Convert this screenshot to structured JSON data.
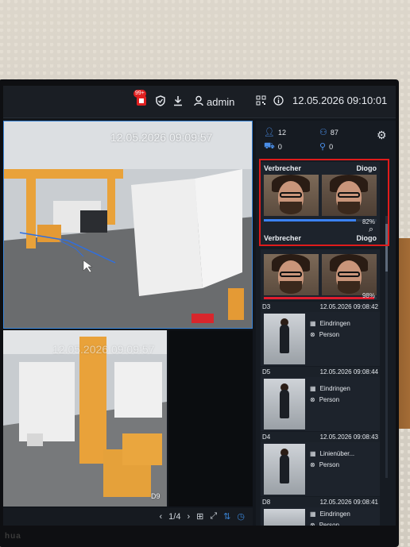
{
  "topbar": {
    "alarm_badge": "99+",
    "user": "admin",
    "datetime": "12.05.2026 09:10:01",
    "icons": [
      "alarm-icon",
      "shield-icon",
      "download-icon",
      "user-icon",
      "qr-code-icon",
      "info-icon"
    ]
  },
  "camera_main": {
    "timestamp": "12.05.2026 09:09:57"
  },
  "camera_bottom": {
    "timestamp": "12.05.2026 09:09:57",
    "channel": "D9"
  },
  "bottom_bar": {
    "page": "1/4"
  },
  "stats": {
    "person_count": "12",
    "people_flow": "87",
    "vehicle_count": "0",
    "nonmotor_count": "0"
  },
  "face_matches": [
    {
      "label_left": "Verbrecher",
      "label_right": "Diogo",
      "similarity": "82%",
      "similarity_value": 0.82,
      "bar_color": "#3b82f6"
    },
    {
      "label_left": "Verbrecher",
      "label_right": "Diogo",
      "similarity": "98%",
      "similarity_value": 0.98,
      "bar_color": "#e11d2e"
    }
  ],
  "events": [
    {
      "channel": "D3",
      "time": "12.05.2026 09:08:42",
      "rule": "Eindringen",
      "type": "Person"
    },
    {
      "channel": "D5",
      "time": "12.05.2026 09:08:44",
      "rule": "Eindringen",
      "type": "Person"
    },
    {
      "channel": "D4",
      "time": "12.05.2026 09:08:43",
      "rule": "Linienüber...",
      "type": "Person"
    },
    {
      "channel": "D8",
      "time": "12.05.2026 09:08:41",
      "rule": "Eindringen",
      "type": "Person"
    }
  ],
  "brand": "hua",
  "colors": {
    "accent": "#3a84d6",
    "highlight": "#e01b1b"
  }
}
